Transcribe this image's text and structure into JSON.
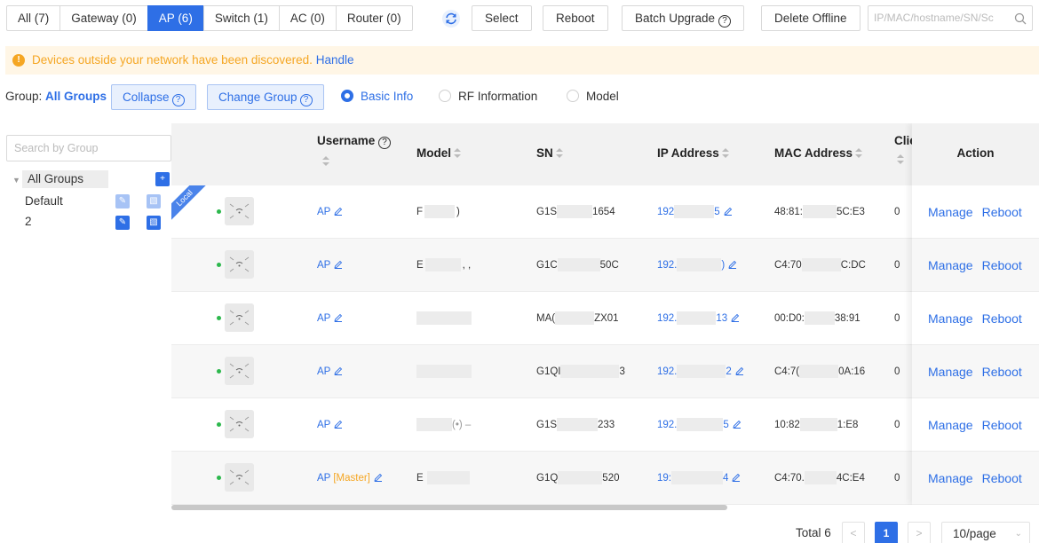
{
  "tabs": [
    {
      "label": "All (7)",
      "active": false
    },
    {
      "label": "Gateway (0)",
      "active": false
    },
    {
      "label": "AP (6)",
      "active": true
    },
    {
      "label": "Switch (1)",
      "active": false
    },
    {
      "label": "AC (0)",
      "active": false
    },
    {
      "label": "Router (0)",
      "active": false
    }
  ],
  "toolbar": {
    "select": "Select",
    "reboot": "Reboot",
    "batch_upgrade": "Batch Upgrade",
    "delete_offline": "Delete Offline",
    "search_placeholder": "IP/MAC/hostname/SN/Sᴄ"
  },
  "alert": {
    "message": "Devices outside your network have been discovered.",
    "action": "Handle"
  },
  "group": {
    "label": "Group:",
    "value": "All Groups",
    "collapse": "Collapse",
    "change_group": "Change Group",
    "views": [
      "Basic Info",
      "RF Information",
      "Model"
    ],
    "selected_view": "Basic Info"
  },
  "sidebar": {
    "search_placeholder": "Search by Group",
    "tree": [
      {
        "label": "All Groups"
      },
      {
        "label": "Default"
      },
      {
        "label": "2"
      }
    ]
  },
  "table": {
    "headers": {
      "username": "Username",
      "model": "Model",
      "sn": "SN",
      "ip": "IP Address",
      "mac": "MAC Address",
      "clients": "Clie",
      "action": "Action"
    },
    "local_badge": "Local",
    "rows": [
      {
        "username": "AP",
        "master": "",
        "model_a": "F",
        "model_b": ")",
        "sn_a": "G1S",
        "sn_b": "1654",
        "ip_a": "192",
        "ip_b": "5",
        "mac_a": "48:81:",
        "mac_b": "5C:E3",
        "clients": "0"
      },
      {
        "username": "AP",
        "master": "",
        "model_a": "E",
        "model_b": ", ,",
        "sn_a": "G1C",
        "sn_b": "50C",
        "ip_a": "192.",
        "ip_b": ")",
        "mac_a": "C4:70",
        "mac_b": "C:DC",
        "clients": "0"
      },
      {
        "username": "AP",
        "master": "",
        "model_a": "",
        "model_b": "",
        "sn_a": "MA(",
        "sn_b": "ZX01",
        "ip_a": "192.",
        "ip_b": "13",
        "mac_a": "00:D0:",
        "mac_b": "38:91",
        "clients": "0"
      },
      {
        "username": "AP",
        "master": "",
        "model_a": "",
        "model_b": "",
        "sn_a": "G1QI",
        "sn_b": "3",
        "ip_a": "192.",
        "ip_b": "2",
        "mac_a": "C4:7(",
        "mac_b": "0A:16",
        "clients": "0"
      },
      {
        "username": "AP",
        "master": "",
        "model_a": "",
        "model_b": "(•) –",
        "sn_a": "G1S",
        "sn_b": "233",
        "ip_a": "192.",
        "ip_b": "5",
        "mac_a": "10:82",
        "mac_b": "1:E8",
        "clients": "0"
      },
      {
        "username": "AP",
        "master": "[Master]",
        "model_a": "E",
        "model_b": "",
        "sn_a": "G1Q",
        "sn_b": "520",
        "ip_a": "19:",
        "ip_b": "4",
        "mac_a": "C4:70.",
        "mac_b": "4C:E4",
        "clients": "0"
      }
    ],
    "action_manage": "Manage",
    "action_reboot": "Reboot"
  },
  "pagination": {
    "total": "Total 6",
    "current": "1",
    "page_size": "10/page"
  },
  "colors": {
    "primary": "#2e6fe6",
    "warning": "#f5a623",
    "online": "#2db84d"
  }
}
